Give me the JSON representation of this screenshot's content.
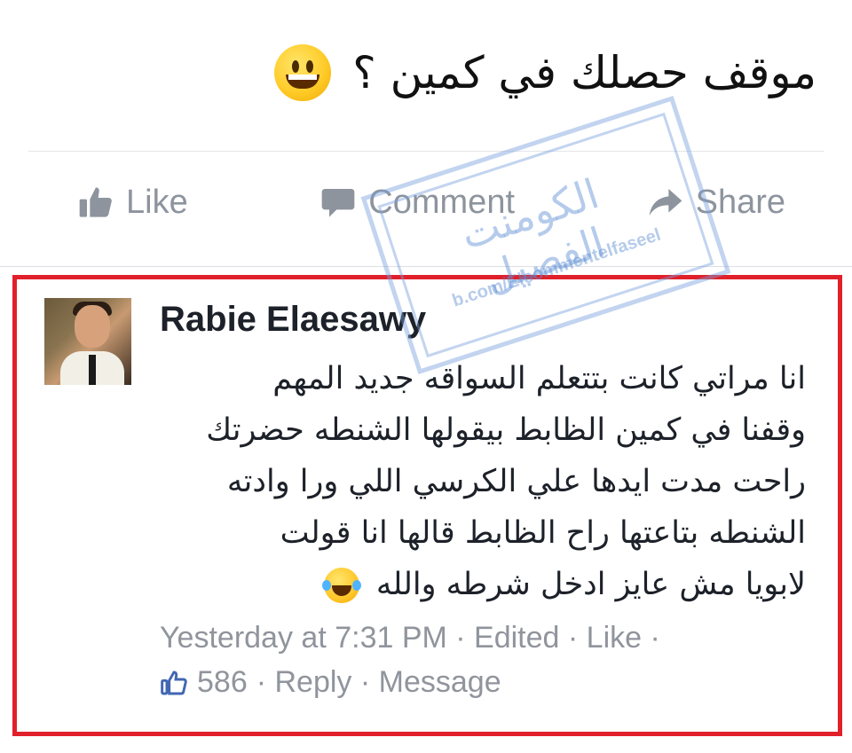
{
  "post": {
    "text": "موقف حصلك في كمين ؟",
    "emoji": "smiling-face-emoji"
  },
  "actions": {
    "like": "Like",
    "comment": "Comment",
    "share": "Share"
  },
  "comment": {
    "author": "Rabie Elaesawy",
    "lines": [
      "انا مراتي كانت بتتعلم السواقه جديد المهم",
      "وقفنا في كمين الظابط بيقولها الشنطه حضرتك",
      "راحت مدت ايدها علي الكرسي اللي ورا وادته",
      "الشنطه بتاعتها راح الظابط قالها انا قولت",
      "لابويا مش عايز ادخل شرطه والله"
    ],
    "emoji": "tears-of-joy-emoji",
    "meta_line": "Yesterday at 7:31 PM · Edited · Like ·",
    "like_count": "586",
    "reply": "· Reply · Message"
  },
  "watermark": {
    "arabic": "الكومنت الفصيل",
    "url": "b.com/Elcommentelfaseel"
  },
  "colors": {
    "highlight_border": "#e0202a",
    "action_gray": "#8d949e",
    "meta_gray": "#90949c",
    "like_blue": "#4267b2"
  }
}
